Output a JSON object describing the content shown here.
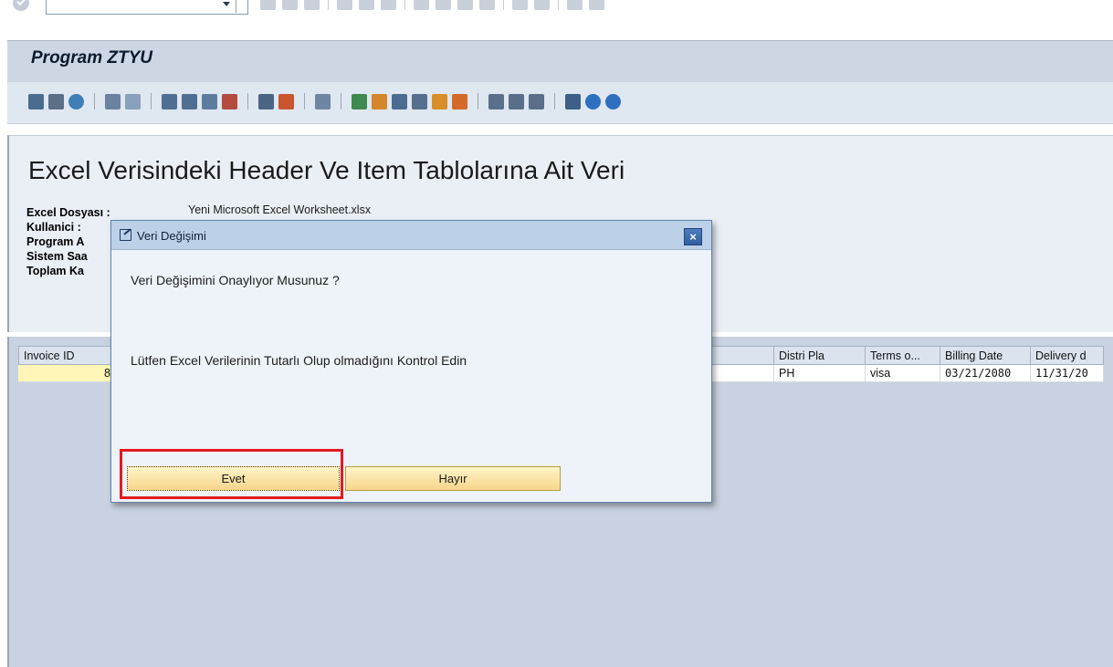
{
  "system_toolbar": {
    "command_field_value": ""
  },
  "window": {
    "title": "Program ZTYU"
  },
  "report": {
    "title": "Excel Verisindeki Header Ve Item Tablolarına Ait Veri",
    "meta_labels": [
      "Excel Dosyası :",
      "Kullanici :",
      "Program A",
      "Sistem Saa",
      "Toplam Ka"
    ],
    "file_value": "Yeni Microsoft Excel Worksheet.xlsx"
  },
  "grid": {
    "columns": [
      "Invoice ID",
      "",
      "Distri Pla",
      "Terms o...",
      "Billing Date",
      "Delivery d"
    ],
    "rows": [
      [
        "8",
        "",
        "PH",
        "visa",
        "03/21/2080",
        "11/31/20"
      ]
    ]
  },
  "dialog": {
    "title": "Veri Değişimi",
    "message": "Veri Değişimini Onaylıyor Musunuz ?",
    "detail": "Lütfen Excel Verilerinin Tutarlı Olup olmadığını Kontrol Edin",
    "yes_label": "Evet",
    "no_label": "Hayır",
    "close_label": "×"
  },
  "colors": {
    "title_bar": "#cdd7e3",
    "dialog_header": "#bcd0e8",
    "button": "#f7d58a",
    "highlight": "#e3191f",
    "key_cell": "#fff6b8"
  },
  "icons": {
    "system_toolbar": [
      "enter-icon",
      "back-icon",
      "exit-icon",
      "cancel-icon",
      "print-icon",
      "find-icon",
      "find-next-icon",
      "first-page-icon",
      "previous-page-icon",
      "next-page-icon",
      "last-page-icon",
      "new-session-icon",
      "shortcut-icon",
      "help-icon",
      "layout-icon"
    ],
    "application_toolbar": [
      "details-icon",
      "table-view-icon",
      "refresh-icon",
      "select-all-icon",
      "deselect-all-icon",
      "sort-ascending-icon",
      "sort-descending-icon",
      "filter-icon",
      "delete-filter-icon",
      "total-icon",
      "subtotal-icon",
      "print-preview-icon",
      "export-excel-icon",
      "word-processing-icon",
      "local-file-icon",
      "abc-analysis-icon",
      "graphic-icon",
      "change-layout-icon",
      "select-layout-icon",
      "save-layout-icon",
      "information-icon",
      "save-icon",
      "add-icon",
      "remove-icon"
    ]
  }
}
